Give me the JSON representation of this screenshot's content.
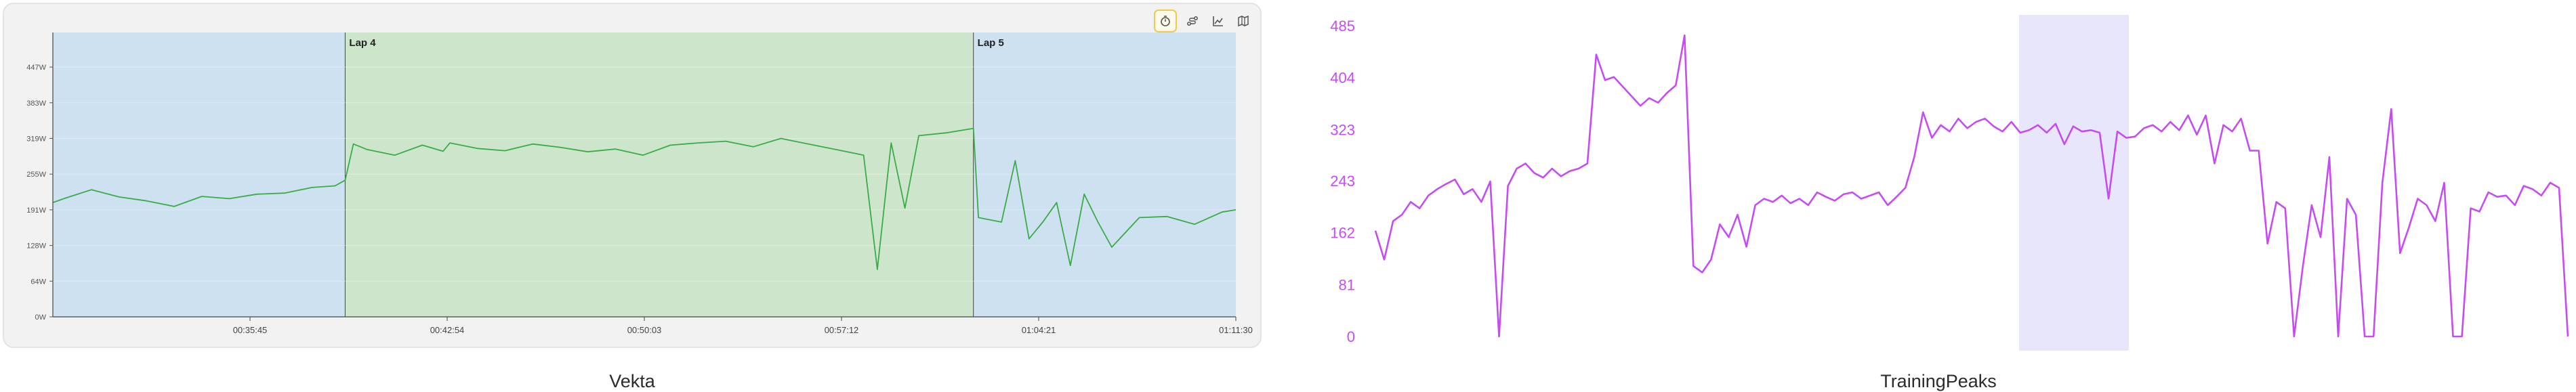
{
  "captions": {
    "left": "Vekta",
    "right": "TrainingPeaks"
  },
  "toolbar": {
    "buttons": [
      {
        "icon": "stopwatch-icon",
        "active": true
      },
      {
        "icon": "route-icon",
        "active": false
      },
      {
        "icon": "chart-icon",
        "active": false
      },
      {
        "icon": "map-icon",
        "active": false
      }
    ]
  },
  "colors": {
    "vekta_line": "#3aab47",
    "vekta_lap_blue": "#cde1f1",
    "vekta_lap_green": "#cde6cb",
    "tp_line": "#c54cf5",
    "tp_axis_text": "#c54cf5",
    "tp_highlight": "#e8e6fb"
  },
  "chart_data": [
    {
      "type": "line",
      "x_range": [
        "00:28:36",
        "01:11:30"
      ],
      "x_ticks": [
        "00:35:45",
        "00:42:54",
        "00:50:03",
        "00:57:12",
        "01:04:21",
        "01:11:30"
      ],
      "y_ticks": [
        "0W",
        "64W",
        "128W",
        "191W",
        "255W",
        "319W",
        "383W",
        "447W"
      ],
      "ylim": [
        0,
        510
      ],
      "laps": [
        {
          "label": "",
          "start": "00:28:36",
          "end": "00:39:12",
          "color": "blue"
        },
        {
          "label": "Lap 4",
          "start": "00:39:12",
          "end": "01:01:59",
          "color": "green"
        },
        {
          "label": "Lap 5",
          "start": "01:01:59",
          "end": "01:11:30",
          "color": "blue"
        }
      ],
      "series": [
        {
          "x": [
            "00:28:36",
            "00:29:00",
            "00:30:00",
            "00:31:00",
            "00:32:00",
            "00:33:00",
            "00:34:00",
            "00:35:00",
            "00:36:00",
            "00:37:00",
            "00:38:00",
            "00:38:50",
            "00:39:12",
            "00:39:30",
            "00:40:00",
            "00:41:00",
            "00:42:00",
            "00:42:45",
            "00:43:00",
            "00:44:00",
            "00:45:00",
            "00:46:00",
            "00:47:00",
            "00:48:00",
            "00:49:00",
            "00:50:00",
            "00:51:00",
            "00:52:00",
            "00:53:00",
            "00:54:00",
            "00:55:00",
            "00:56:00",
            "00:57:00",
            "00:58:00",
            "00:58:30",
            "00:59:00",
            "00:59:30",
            "01:00:00",
            "01:01:00",
            "01:01:59",
            "01:02:10",
            "01:03:00",
            "01:03:30",
            "01:04:00",
            "01:04:30",
            "01:05:00",
            "01:05:30",
            "01:06:00",
            "01:06:30",
            "01:07:00",
            "01:08:00",
            "01:09:00",
            "01:10:00",
            "01:11:00",
            "01:11:30"
          ],
          "y": [
            205,
            212,
            228,
            215,
            208,
            198,
            216,
            212,
            220,
            222,
            232,
            235,
            245,
            310,
            300,
            290,
            308,
            297,
            312,
            302,
            298,
            310,
            304,
            296,
            301,
            290,
            308,
            312,
            315,
            305,
            320,
            310,
            300,
            290,
            85,
            312,
            195,
            325,
            330,
            338,
            178,
            170,
            280,
            140,
            170,
            205,
            92,
            220,
            170,
            125,
            178,
            180,
            166,
            188,
            192
          ]
        }
      ]
    },
    {
      "type": "line",
      "y_ticks": [
        "0",
        "81",
        "162",
        "243",
        "323",
        "404",
        "485"
      ],
      "ylim": [
        0,
        485
      ],
      "series": [
        {
          "y": [
            165,
            120,
            180,
            190,
            210,
            200,
            220,
            230,
            238,
            245,
            222,
            230,
            210,
            242,
            0,
            235,
            262,
            270,
            255,
            248,
            262,
            250,
            258,
            262,
            270,
            440,
            400,
            405,
            390,
            375,
            360,
            372,
            365,
            380,
            392,
            470,
            110,
            100,
            120,
            175,
            155,
            190,
            140,
            205,
            215,
            210,
            220,
            208,
            215,
            205,
            225,
            218,
            212,
            222,
            225,
            215,
            220,
            225,
            205,
            218,
            232,
            280,
            350,
            310,
            330,
            320,
            340,
            325,
            335,
            340,
            328,
            320,
            335,
            318,
            322,
            330,
            318,
            332,
            300,
            328,
            320,
            322,
            318,
            215,
            320,
            310,
            312,
            325,
            330,
            320,
            335,
            322,
            345,
            315,
            345,
            270,
            330,
            320,
            340,
            290,
            290,
            145,
            210,
            200,
            0,
            110,
            205,
            155,
            280,
            0,
            215,
            190,
            0,
            0,
            240,
            355,
            130,
            170,
            215,
            205,
            180,
            240,
            0,
            0,
            200,
            195,
            225,
            218,
            220,
            205,
            235,
            230,
            220,
            240,
            232,
            0
          ]
        }
      ]
    }
  ]
}
